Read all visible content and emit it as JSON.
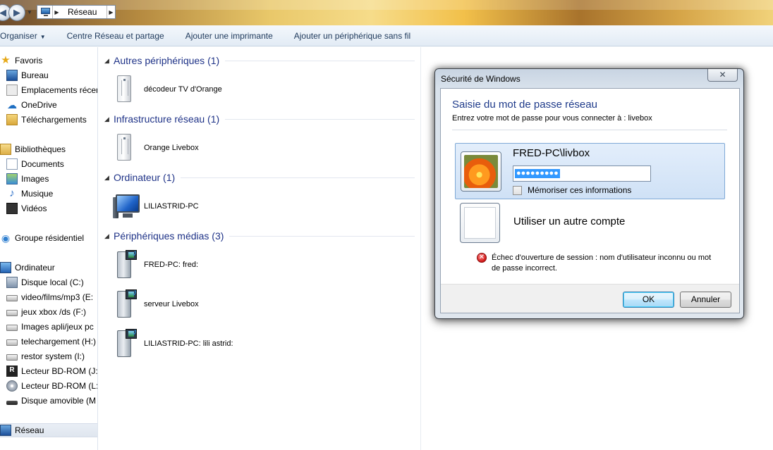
{
  "address_bar": {
    "location": "Réseau"
  },
  "command_bar": {
    "items": [
      "Organiser",
      "Centre Réseau et partage",
      "Ajouter une imprimante",
      "Ajouter un périphérique sans fil"
    ]
  },
  "sidebar": {
    "favorites": [
      "Favoris",
      "Bureau",
      "Emplacements récen",
      "OneDrive",
      "Téléchargements"
    ],
    "libraries": [
      "Bibliothèques",
      "Documents",
      "Images",
      "Musique",
      "Vidéos"
    ],
    "homegroup": "Groupe résidentiel",
    "computer": [
      "Ordinateur",
      "Disque local (C:)",
      "video/films/mp3 (E:",
      "jeux  xbox /ds  (F:)",
      "Images apli/jeux pc",
      "telechargement (H:)",
      "restor system (I:)",
      "Lecteur BD-ROM (J:)",
      "Lecteur BD-ROM (L:)",
      "Disque amovible (M"
    ],
    "network": "Réseau"
  },
  "content": {
    "groups": [
      {
        "header": "Autres périphériques (1)",
        "devices": [
          "décodeur TV d'Orange"
        ]
      },
      {
        "header": "Infrastructure réseau (1)",
        "devices": [
          "Orange Livebox"
        ]
      },
      {
        "header": "Ordinateur (1)",
        "devices": [
          "LILIASTRID-PC"
        ]
      },
      {
        "header": "Périphériques médias (3)",
        "devices": [
          "FRED-PC: fred:",
          "serveur Livebox",
          "LILIASTRID-PC: lili astrid:"
        ]
      }
    ]
  },
  "dialog": {
    "title": "Sécurité de Windows",
    "close": "✕",
    "heading": "Saisie du mot de passe réseau",
    "subtitle": "Entrez votre mot de passe pour vous connecter à : livebox",
    "credential": {
      "username": "FRED-PC\\livbox",
      "password_mask": "●●●●●●●●●",
      "remember_label": "Mémoriser ces informations"
    },
    "other_account": "Utiliser un autre compte",
    "error": "Échec d'ouverture de session : nom d'utilisateur inconnu ou mot de passe incorrect.",
    "ok": "OK",
    "cancel": "Annuler"
  }
}
